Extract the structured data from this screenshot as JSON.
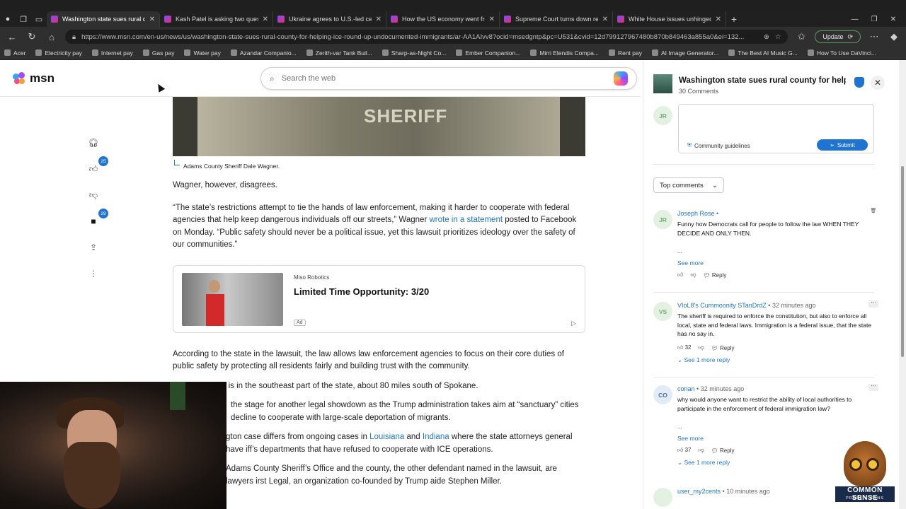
{
  "browser": {
    "tabs": [
      {
        "title": "Washington state sues rural coun",
        "active": true
      },
      {
        "title": "Kash Patel is asking two question",
        "active": false
      },
      {
        "title": "Ukraine agrees to U.S.-led ceasefi",
        "active": false
      },
      {
        "title": "How the US economy went from",
        "active": false
      },
      {
        "title": "Supreme Court turns down religi",
        "active": false
      },
      {
        "title": "White House issues unhinged pr",
        "active": false
      }
    ],
    "url": "https://www.msn.com/en-us/news/us/washington-state-sues-rural-county-for-helping-ice-round-up-undocumented-immigrants/ar-AA1AIvv8?ocid=msedgntp&pc=U531&cvid=12d799127967480b870b849463a855a0&ei=132...",
    "update_label": "Update",
    "bookmarks": [
      "Acer",
      "Electricity pay",
      "Internet pay",
      "Gas pay",
      "Water pay",
      "Azandar Companio...",
      "Zerith-var Tank Buil...",
      "Sharp-as-Night Co...",
      "Ember Companion...",
      "Mirri Elendis Compa...",
      "Rent pay",
      "AI Image Generator...",
      "The Best AI Music G...",
      "How To Use DaVinci..."
    ]
  },
  "msn": {
    "logo_text": "msn",
    "search_placeholder": "Search the web"
  },
  "rail": {
    "like_count": "25",
    "comment_count": "29"
  },
  "article": {
    "hero_text": "SHERIFF",
    "caption": "Adams County Sheriff Dale Wagner.",
    "p1": "Wagner, however, disagrees.",
    "p2_a": "“The state’s restrictions attempt to tie the hands of law enforcement, making it harder to cooperate with federal agencies that help keep dangerous individuals off our streets,” Wagner ",
    "p2_link": "wrote in a statement",
    "p2_b": " posted to Facebook on Monday. “Public safety should never be a political issue, yet this lawsuit prioritizes ideology over the safety of our communities.”",
    "ad": {
      "brand": "Miso Robotics",
      "title": "Limited Time Opportunity: 3/20",
      "tag": "Ad"
    },
    "p3": "According to the state in the lawsuit, the law allows law enforcement agencies to focus on their core duties of public safety by protecting all residents fairly and building trust with the community.",
    "p4": "Adams County is in the southeast part of the state, about 80 miles south of Spokane.",
    "p5": "the stage for another legal showdown as the Trump administration takes aim at “sanctuary” cities decline to cooperate with large-scale deportation of migrants.",
    "p6_a": "gton case differs from ongoing cases in ",
    "p6_link1": "Louisiana",
    "p6_and": " and ",
    "p6_link2": "Indiana",
    "p6_b": " where the state attorneys general have iff’s departments that have refused to cooperate with ICE operations.",
    "p7": "Adams County Sheriff’s Office and the county, the other defendant named in the lawsuit, are lawyers irst Legal, an organization co-founded by Trump aide Stephen Miller."
  },
  "comments_panel": {
    "title": "Washington state sues rural county for helpin...",
    "count": "30 Comments",
    "composer_initials": "JR",
    "guidelines": "Community guidelines",
    "submit": "Submit",
    "sort": "Top comments",
    "comments": [
      {
        "initials": "JR",
        "author": "Joseph Rose",
        "time": "",
        "body": "Funny how Democrats call for people to follow the law WHEN THEY DECIDE AND ONLY THEN.",
        "ellipsis": "...",
        "see_more": "See more",
        "likes": "",
        "reply": "Reply",
        "replies": ""
      },
      {
        "initials": "VS",
        "author": "VIoL8's Cummoonity STanDrdZ",
        "time": "32 minutes ago",
        "body": "The sheriff is required to enforce the constitution, but also to enforce all local, state and federal laws. Immigration is a federal issue, that the state has no say in.",
        "ellipsis": "",
        "see_more": "",
        "likes": "32",
        "reply": "Reply",
        "replies": "See 1 more reply"
      },
      {
        "initials": "CO",
        "author": "conan",
        "time": "32 minutes ago",
        "body": "why would anyone want to restrict the ability of local authorities to participate in the enforcement of federal immigration law?",
        "ellipsis": "...",
        "see_more": "See more",
        "likes": "37",
        "reply": "Reply",
        "replies": "See 1 more reply"
      },
      {
        "initials": "",
        "author": "user_my2cents",
        "time": "10 minutes ago",
        "body": "",
        "ellipsis": "",
        "see_more": "",
        "likes": "",
        "reply": "",
        "replies": ""
      }
    ]
  },
  "overlay": {
    "brand1": "COMMON SENSE",
    "brand2": "PROSE & CONS"
  }
}
